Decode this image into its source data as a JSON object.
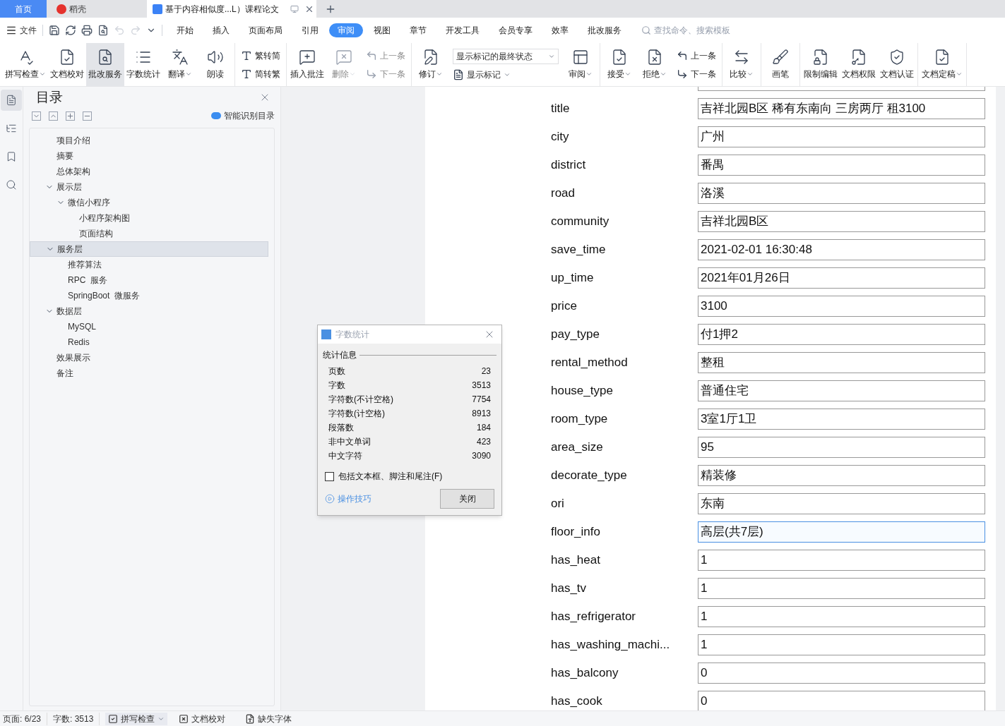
{
  "tabs": [
    {
      "kind": "home",
      "label": "首页",
      "selected": false
    },
    {
      "kind": "app",
      "label": "稻壳",
      "selected": false
    },
    {
      "kind": "doc",
      "label": "基于内容相似度...L）课程论文",
      "selected": true
    }
  ],
  "menu": {
    "file": "文件",
    "items": [
      {
        "label": "开始",
        "selected": false
      },
      {
        "label": "插入",
        "selected": false
      },
      {
        "label": "页面布局",
        "selected": false
      },
      {
        "label": "引用",
        "selected": false
      },
      {
        "label": "审阅",
        "selected": true
      },
      {
        "label": "视图",
        "selected": false
      },
      {
        "label": "章节",
        "selected": false
      },
      {
        "label": "开发工具",
        "selected": false
      },
      {
        "label": "会员专享",
        "selected": false
      },
      {
        "label": "效率",
        "selected": false
      },
      {
        "label": "批改服务",
        "selected": false
      }
    ],
    "search_placeholder": "查找命令、搜索模板"
  },
  "ribbon": [
    {
      "tools": [
        {
          "kind": "large",
          "label": "拼写检查",
          "dropdown": true,
          "disabled": false,
          "selected": false
        },
        {
          "kind": "large",
          "label": "文档校对",
          "dropdown": false,
          "disabled": false,
          "selected": false
        },
        {
          "kind": "large",
          "label": "批改服务",
          "dropdown": false,
          "disabled": false,
          "selected": true
        },
        {
          "kind": "large",
          "label": "字数统计",
          "dropdown": false,
          "disabled": false,
          "selected": false
        },
        {
          "kind": "large",
          "label": "翻译",
          "dropdown": true,
          "disabled": false,
          "selected": false
        },
        {
          "kind": "large",
          "label": "朗读",
          "dropdown": false,
          "disabled": false,
          "selected": false
        }
      ]
    },
    {
      "tools": [
        {
          "kind": "stack",
          "items": [
            {
              "label": "繁转简",
              "disabled": false
            },
            {
              "label": "简转繁",
              "disabled": false
            }
          ]
        }
      ]
    },
    {
      "tools": [
        {
          "kind": "large",
          "label": "插入批注",
          "dropdown": false,
          "disabled": false,
          "selected": false
        },
        {
          "kind": "large",
          "label": "删除",
          "dropdown": true,
          "disabled": true,
          "selected": false
        },
        {
          "kind": "stack",
          "items": [
            {
              "label": "上一条",
              "disabled": true
            },
            {
              "label": "下一条",
              "disabled": true
            }
          ]
        }
      ]
    },
    {
      "tools": [
        {
          "kind": "large",
          "label": "修订",
          "dropdown": true,
          "disabled": false,
          "selected": false
        },
        {
          "kind": "select",
          "value": "显示标记的最终状态",
          "label": "显示标记"
        },
        {
          "kind": "large",
          "label": "审阅",
          "dropdown": true,
          "disabled": false,
          "selected": false
        }
      ]
    },
    {
      "tools": [
        {
          "kind": "large",
          "label": "接受",
          "dropdown": true,
          "disabled": false,
          "selected": false
        },
        {
          "kind": "large",
          "label": "拒绝",
          "dropdown": true,
          "disabled": false,
          "selected": false
        },
        {
          "kind": "stack",
          "items": [
            {
              "label": "上一条",
              "disabled": false
            },
            {
              "label": "下一条",
              "disabled": false
            }
          ]
        }
      ]
    },
    {
      "tools": [
        {
          "kind": "large",
          "label": "比较",
          "dropdown": true,
          "disabled": false,
          "selected": false
        }
      ]
    },
    {
      "tools": [
        {
          "kind": "large",
          "label": "画笔",
          "dropdown": false,
          "disabled": false,
          "selected": false
        }
      ]
    },
    {
      "tools": [
        {
          "kind": "large",
          "label": "限制编辑",
          "dropdown": false,
          "disabled": false,
          "selected": false
        },
        {
          "kind": "large",
          "label": "文档权限",
          "dropdown": false,
          "disabled": false,
          "selected": false
        },
        {
          "kind": "large",
          "label": "文档认证",
          "dropdown": false,
          "disabled": false,
          "selected": false
        }
      ]
    },
    {
      "tools": [
        {
          "kind": "large",
          "label": "文档定稿",
          "dropdown": true,
          "disabled": false,
          "selected": false
        }
      ]
    }
  ],
  "rail": [
    {
      "selected": true
    },
    {
      "selected": false
    },
    {
      "selected": false
    },
    {
      "selected": false
    }
  ],
  "toc": {
    "title": "目录",
    "smart": "智能识别目录",
    "items": [
      {
        "label": "项目介绍",
        "selected": false
      },
      {
        "label": "摘要",
        "selected": false
      },
      {
        "label": "总体架构",
        "selected": false
      },
      {
        "label": "展示层",
        "selected": false,
        "expanded": true,
        "children": [
          {
            "label": "微信小程序",
            "selected": false,
            "expanded": true,
            "children": [
              {
                "label": "小程序架构图",
                "selected": false
              },
              {
                "label": "页面结构",
                "selected": false
              }
            ]
          }
        ]
      },
      {
        "label": "服务层",
        "selected": true,
        "expanded": true,
        "children": [
          {
            "label": "推荐算法",
            "selected": false
          },
          {
            "label": "RPC  服务",
            "selected": false
          },
          {
            "label": "SpringBoot  微服务",
            "selected": false
          }
        ]
      },
      {
        "label": "数据层",
        "selected": false,
        "expanded": true,
        "children": [
          {
            "label": "MySQL",
            "selected": false
          },
          {
            "label": "Redis",
            "selected": false
          }
        ]
      },
      {
        "label": "效果展示",
        "selected": false
      },
      {
        "label": "备注",
        "selected": false
      }
    ]
  },
  "document": {
    "rows": [
      {
        "label": "title",
        "value": "吉祥北园B区 稀有东南向 三房两厅 租3100",
        "focused": false
      },
      {
        "label": "city",
        "value": "广州",
        "focused": false
      },
      {
        "label": "district",
        "value": "番禺",
        "focused": false
      },
      {
        "label": "road",
        "value": "洛溪",
        "focused": false
      },
      {
        "label": "community",
        "value": "吉祥北园B区",
        "focused": false
      },
      {
        "label": "save_time",
        "value": "2021-02-01 16:30:48",
        "focused": false
      },
      {
        "label": "up_time",
        "value": "2021年01月26日",
        "focused": false
      },
      {
        "label": "price",
        "value": "3100",
        "focused": false
      },
      {
        "label": "pay_type",
        "value": "付1押2",
        "focused": false
      },
      {
        "label": "rental_method",
        "value": "整租",
        "focused": false
      },
      {
        "label": "house_type",
        "value": "普通住宅",
        "focused": false
      },
      {
        "label": "room_type",
        "value": "3室1厅1卫",
        "focused": false
      },
      {
        "label": "area_size",
        "value": "95",
        "focused": false
      },
      {
        "label": "decorate_type",
        "value": "精装修",
        "focused": false
      },
      {
        "label": "ori",
        "value": "东南",
        "focused": false
      },
      {
        "label": "floor_info",
        "value": "高层(共7层)",
        "focused": true
      },
      {
        "label": "has_heat",
        "value": "1",
        "focused": false
      },
      {
        "label": "has_tv",
        "value": "1",
        "focused": false
      },
      {
        "label": "has_refrigerator",
        "value": "1",
        "focused": false
      },
      {
        "label": "has_washing_machi...",
        "value": "1",
        "focused": false
      },
      {
        "label": "has_balcony",
        "value": "0",
        "focused": false
      },
      {
        "label": "has_cook",
        "value": "0",
        "focused": false
      }
    ]
  },
  "dialog": {
    "title": "字数统计",
    "section": "统计信息",
    "stats": [
      {
        "label": "页数",
        "value": "23"
      },
      {
        "label": "字数",
        "value": "3513"
      },
      {
        "label": "字符数(不计空格)",
        "value": "7754"
      },
      {
        "label": "字符数(计空格)",
        "value": "8913"
      },
      {
        "label": "段落数",
        "value": "184"
      },
      {
        "label": "非中文单词",
        "value": "423"
      },
      {
        "label": "中文字符",
        "value": "3090"
      }
    ],
    "checkbox": {
      "label": "包括文本框、脚注和尾注(F)",
      "checked": false
    },
    "link": "操作技巧",
    "button": "关闭"
  },
  "status_bar": [
    {
      "kind": "text",
      "label": "页面: 6/23"
    },
    {
      "kind": "text",
      "label": "字数: 3513"
    },
    {
      "kind": "spell",
      "label": "拼写检查"
    },
    {
      "kind": "proof",
      "label": "文档校对"
    },
    {
      "kind": "font",
      "label": "缺失字体"
    }
  ]
}
